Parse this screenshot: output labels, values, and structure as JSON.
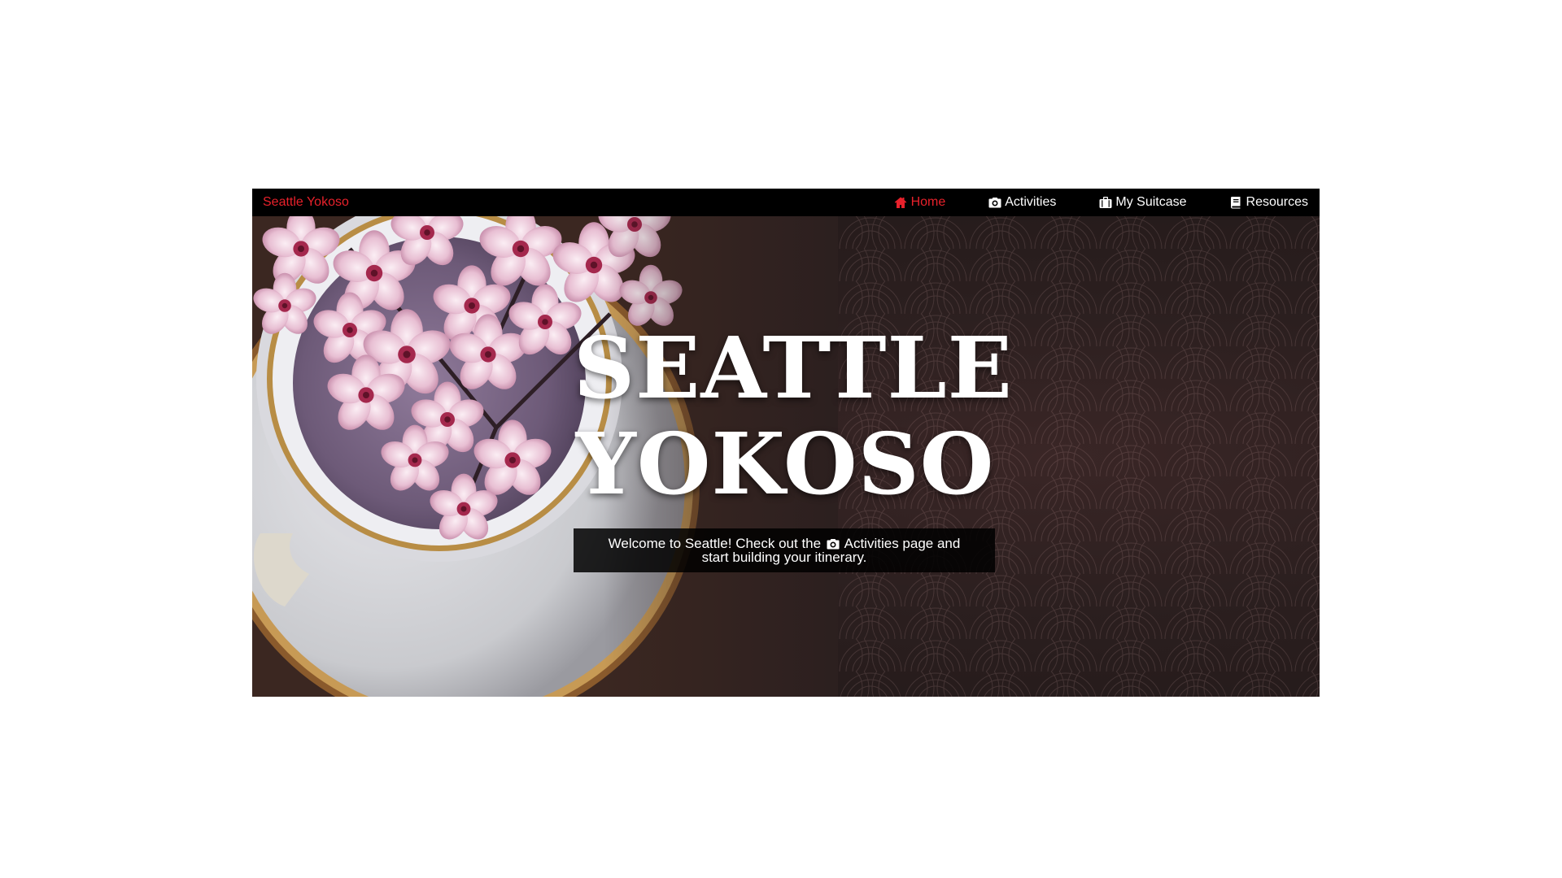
{
  "navbar": {
    "brand": "Seattle Yokoso",
    "items": [
      {
        "label": "Home",
        "icon": "home-icon",
        "active": true
      },
      {
        "label": "Activities",
        "icon": "camera-icon",
        "active": false
      },
      {
        "label": "My Suitcase",
        "icon": "suitcase-icon",
        "active": false
      },
      {
        "label": "Resources",
        "icon": "book-icon",
        "active": false
      }
    ]
  },
  "hero": {
    "title_line1": "SEATTLE",
    "title_line2": "YOKOSO",
    "welcome_before": "Welcome to Seattle! Check out the",
    "welcome_icon": "camera-icon",
    "welcome_after": "Activities page and",
    "welcome_line2": "start building your itinerary."
  },
  "colors": {
    "accent": "#e8212b",
    "navbar_bg": "#000000",
    "hero_bg": "#2b1f1f"
  }
}
